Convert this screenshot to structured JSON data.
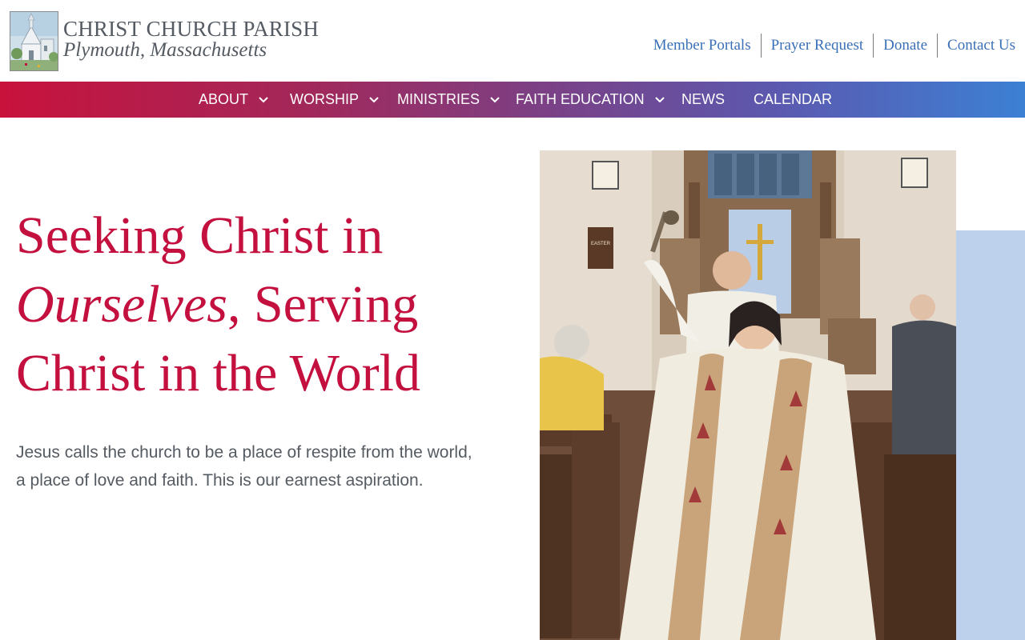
{
  "header": {
    "title": "CHRIST CHURCH PARISH",
    "subtitle": "Plymouth, Massachusetts",
    "logo_icon": "church-illustration-icon",
    "utility_links": [
      "Member Portals",
      "Prayer Request",
      "Donate",
      "Contact Us"
    ]
  },
  "nav": {
    "items": [
      {
        "label": "ABOUT",
        "has_dropdown": true
      },
      {
        "label": "WORSHIP",
        "has_dropdown": true
      },
      {
        "label": "MINISTRIES",
        "has_dropdown": true
      },
      {
        "label": "FAITH EDUCATION",
        "has_dropdown": true
      },
      {
        "label": "NEWS",
        "has_dropdown": false
      },
      {
        "label": "CALENDAR",
        "has_dropdown": false
      }
    ],
    "gradient": [
      "#c8123c",
      "#3c80d4"
    ]
  },
  "hero": {
    "heading_part1": "Seeking Christ in",
    "heading_italic": "Ourselves",
    "heading_part2": ", Serving",
    "heading_part3": "Christ in the World",
    "body": "Jesus calls the church to be a place of respite from the world, a place of love and faith. This is our earnest aspiration.",
    "photo_description_icon": "clergy-procession-photo",
    "photo_sign_text": "EASTER"
  },
  "colors": {
    "brand_red": "#c4103f",
    "link_blue": "#3a70b8",
    "text_gray": "#555b62",
    "accent_blue": "#bdd1ec"
  }
}
